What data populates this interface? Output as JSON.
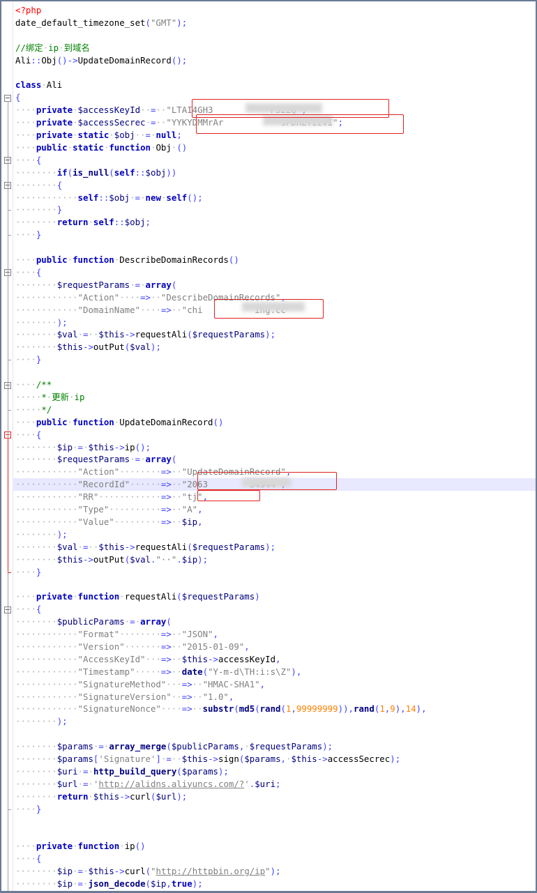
{
  "editor": {
    "lines": [
      {
        "t": "<?php",
        "c": "php"
      },
      {
        "t": "date_default_timezone_set(\"GMT\");",
        "c": "code"
      },
      {
        "t": "",
        "c": "code"
      },
      {
        "t": "//绑定·ip·到域名",
        "c": "cm"
      },
      {
        "t": "Ali::Obj()->UpdateDomainRecord();",
        "c": "code"
      },
      {
        "t": "",
        "c": "code"
      },
      {
        "t": "class·Ali",
        "c": "code"
      },
      {
        "t": "{",
        "c": "code"
      },
      {
        "t": "····private·$accessKeyId··=··\"LTAI4GH3           F322Q\";",
        "c": "code"
      },
      {
        "t": "····private·$accessSecrec·=··\"YYKYDMMrAr           sPDHEYIzvI\";",
        "c": "code"
      },
      {
        "t": "····private·static·$obj··=·null;",
        "c": "code"
      },
      {
        "t": "····public·static·function·Obj·()",
        "c": "code"
      },
      {
        "t": "····{",
        "c": "code"
      },
      {
        "t": "········if(is_null(self::$obj))",
        "c": "code"
      },
      {
        "t": "········{",
        "c": "code"
      },
      {
        "t": "············self::$obj·=·new·self();",
        "c": "code"
      },
      {
        "t": "········}",
        "c": "code"
      },
      {
        "t": "········return·self::$obj;",
        "c": "code"
      },
      {
        "t": "····}",
        "c": "code"
      },
      {
        "t": "",
        "c": "code"
      },
      {
        "t": "····public·function·DescribeDomainRecords()",
        "c": "code"
      },
      {
        "t": "····{",
        "c": "code"
      },
      {
        "t": "········$requestParams·=·array(",
        "c": "code"
      },
      {
        "t": "············\"Action\"····=>··\"DescribeDomainRecords\",",
        "c": "code"
      },
      {
        "t": "············\"DomainName\"····=>··\"chi          ing.cc\"",
        "c": "code"
      },
      {
        "t": "········);",
        "c": "code"
      },
      {
        "t": "········$val·=··$this->requestAli($requestParams);",
        "c": "code"
      },
      {
        "t": "········$this->outPut($val);",
        "c": "code"
      },
      {
        "t": "····}",
        "c": "code"
      },
      {
        "t": "",
        "c": "code"
      },
      {
        "t": "····/**",
        "c": "cm"
      },
      {
        "t": "·····*·更新·ip",
        "c": "cm"
      },
      {
        "t": "·····*/",
        "c": "cm"
      },
      {
        "t": "····public·function·UpdateDomainRecord()",
        "c": "code"
      },
      {
        "t": "····{",
        "c": "code"
      },
      {
        "t": "········$ip·=·$this->ip();",
        "c": "code"
      },
      {
        "t": "········$requestParams·=·array(",
        "c": "code"
      },
      {
        "t": "············\"Action\"········=>··\"UpdateDomainRecord\",",
        "c": "code"
      },
      {
        "t": "············\"RecordId\"······=>··\"2063        54944\",",
        "c": "code"
      },
      {
        "t": "············\"RR\"············=>··\"tj\",",
        "c": "code"
      },
      {
        "t": "············\"Type\"··········=>··\"A\",",
        "c": "code"
      },
      {
        "t": "············\"Value\"·········=>··$ip,",
        "c": "code"
      },
      {
        "t": "········);",
        "c": "code"
      },
      {
        "t": "········$val·=··$this->requestAli($requestParams);",
        "c": "code"
      },
      {
        "t": "········$this->outPut($val.\"··\".$ip);",
        "c": "code"
      },
      {
        "t": "····}",
        "c": "code"
      },
      {
        "t": "",
        "c": "code"
      },
      {
        "t": "····private·function·requestAli($requestParams)",
        "c": "code"
      },
      {
        "t": "····{",
        "c": "code"
      },
      {
        "t": "········$publicParams·=·array(",
        "c": "code"
      },
      {
        "t": "············\"Format\"········=>··\"JSON\",",
        "c": "code"
      },
      {
        "t": "············\"Version\"·······=>··\"2015-01-09\",",
        "c": "code"
      },
      {
        "t": "············\"AccessKeyId\"···=>··$this->accessKeyId,",
        "c": "code"
      },
      {
        "t": "············\"Timestamp\"·····=>··date(\"Y-m-d\\TH:i:s\\Z\"),",
        "c": "code"
      },
      {
        "t": "············\"SignatureMethod\"···=>··\"HMAC-SHA1\",",
        "c": "code"
      },
      {
        "t": "············\"SignatureVersion\"··=>··\"1.0\",",
        "c": "code"
      },
      {
        "t": "············\"SignatureNonce\"····=>··substr(md5(rand(1,99999999)),rand(1,9),14),",
        "c": "code"
      },
      {
        "t": "········);",
        "c": "code"
      },
      {
        "t": "",
        "c": "code"
      },
      {
        "t": "········$params·=·array_merge($publicParams,·$requestParams);",
        "c": "code"
      },
      {
        "t": "········$params['Signature']·=··$this->sign($params,·$this->accessSecrec);",
        "c": "code"
      },
      {
        "t": "········$uri·=·http_build_query($params);",
        "c": "code"
      },
      {
        "t": "········$url·=·'http://alidns.aliyuncs.com/?'.$uri;",
        "c": "code"
      },
      {
        "t": "········return·$this->curl($url);",
        "c": "code"
      },
      {
        "t": "····}",
        "c": "code"
      },
      {
        "t": "",
        "c": "code"
      },
      {
        "t": "",
        "c": "code"
      },
      {
        "t": "····private·function·ip()",
        "c": "code"
      },
      {
        "t": "····{",
        "c": "code"
      },
      {
        "t": "········$ip·=·$this->curl(\"http://httpbin.org/ip\");",
        "c": "code"
      },
      {
        "t": "········$ip·=·json_decode($ip,true);",
        "c": "code"
      }
    ]
  }
}
